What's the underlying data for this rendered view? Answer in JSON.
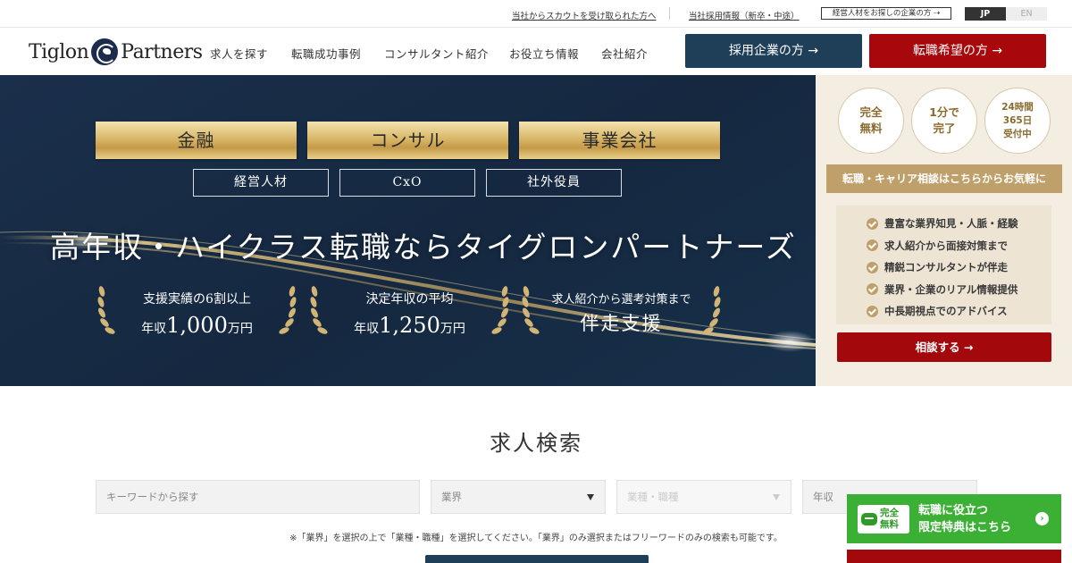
{
  "topbar": {
    "scout_link": "当社からスカウトを受け取られた方へ",
    "recruit_link": "当社採用情報（新卒・中途）",
    "exec_link": "経営人材をお探しの企業の方 ⇢",
    "lang_jp": "JP",
    "lang_en": "EN"
  },
  "header": {
    "logo_left": "Tiglon",
    "logo_right": "Partners",
    "nav": [
      "求人を探す",
      "転職成功事例",
      "コンサルタント紹介",
      "お役立ち情報",
      "会社紹介"
    ],
    "company_button": "採用企業の方 →",
    "seeker_button": "転職希望の方 →"
  },
  "hero": {
    "gold_tags": [
      "金融",
      "コンサル",
      "事業会社"
    ],
    "outline_tags": [
      "経営人材",
      "CxO",
      "社外役員"
    ],
    "catchcopy": "高年収・ハイクラス転職ならタイグロンパートナーズ",
    "stats": [
      {
        "line1": "支援実績の6割以上",
        "prefix": "年収",
        "number": "1,000",
        "suffix": "万円"
      },
      {
        "line1": "決定年収の平均",
        "prefix": "年収",
        "number": "1,250",
        "suffix": "万円"
      },
      {
        "line1": "求人紹介から選考対策まで",
        "line2": "伴走支援"
      }
    ]
  },
  "side": {
    "badges": [
      {
        "l1": "完全",
        "l2": "無料"
      },
      {
        "l1": "1分で",
        "l2": "完了"
      },
      {
        "l1": "24時間",
        "l2": "365日",
        "l3": "受付中"
      }
    ],
    "heading": "転職・キャリア相談はこちらからお気軽に",
    "items": [
      "豊富な業界知見・人脈・経験",
      "求人紹介から面接対策まで",
      "精鋭コンサルタントが伴走",
      "業界・企業のリアル情報提供",
      "中長期視点でのアドバイス"
    ],
    "button": "相談する →"
  },
  "search": {
    "title": "求人検索",
    "keyword_placeholder": "キーワードから探す",
    "industry": "業界",
    "occupation": "業種・職種",
    "salary": "年収",
    "note": "※「業界」を選択の上で「業種・職種」を選択してください。「業界」のみ選択またはフリーワードのみの検索も可能です。"
  },
  "floating": {
    "tag_l1": "完全",
    "tag_l2": "無料",
    "text_l1": "転職に役立つ",
    "text_l2": "限定特典はこちら",
    "arrow": "›"
  },
  "colors": {
    "navy": "#1f3e57",
    "red": "#a8080c",
    "gold": "#c0a06a",
    "green": "#3cb035"
  }
}
